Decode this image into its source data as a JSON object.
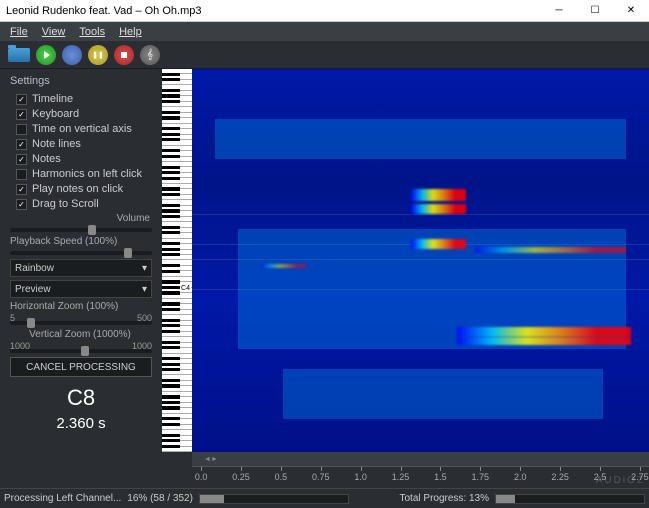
{
  "window": {
    "title": "Leonid Rudenko feat. Vad – Oh Oh.mp3"
  },
  "menu": [
    "File",
    "View",
    "Tools",
    "Help"
  ],
  "settings": {
    "header": "Settings",
    "checks": [
      {
        "label": "Timeline",
        "checked": true
      },
      {
        "label": "Keyboard",
        "checked": true
      },
      {
        "label": "Time on vertical axis",
        "checked": false
      },
      {
        "label": "Note lines",
        "checked": true
      },
      {
        "label": "Notes",
        "checked": true
      },
      {
        "label": "Harmonics on left click",
        "checked": false
      },
      {
        "label": "Play notes on click",
        "checked": true
      },
      {
        "label": "Drag to Scroll",
        "checked": true
      }
    ],
    "volume_label": "Volume",
    "speed_label": "Playback Speed (100%)",
    "color_scheme": "Rainbow",
    "preview_dd": "Preview",
    "hzoom_label": "Horizontal Zoom (100%)",
    "hzoom_min": "5",
    "hzoom_max": "500",
    "vzoom_label": "Vertical Zoom (1000%)",
    "vzoom_min": "1000",
    "vzoom_max": "1000",
    "cancel_btn": "CANCEL PROCESSING",
    "note_readout": "C8",
    "time_readout": "2.360 s"
  },
  "keyboard": {
    "c4_label": "C4"
  },
  "ruler": {
    "ticks": [
      "0.0",
      "0.25",
      "0.5",
      "0.75",
      "1.0",
      "1.25",
      "1.5",
      "1.75",
      "2.0",
      "2.25",
      "2.5",
      "2.75"
    ]
  },
  "status": {
    "left_label": "Processing Left Channel...",
    "left_percent": "16% (58 / 352)",
    "left_fill": 16,
    "total_label": "Total Progress: 13%",
    "total_fill": 13
  },
  "watermark": "AUDiOZ"
}
